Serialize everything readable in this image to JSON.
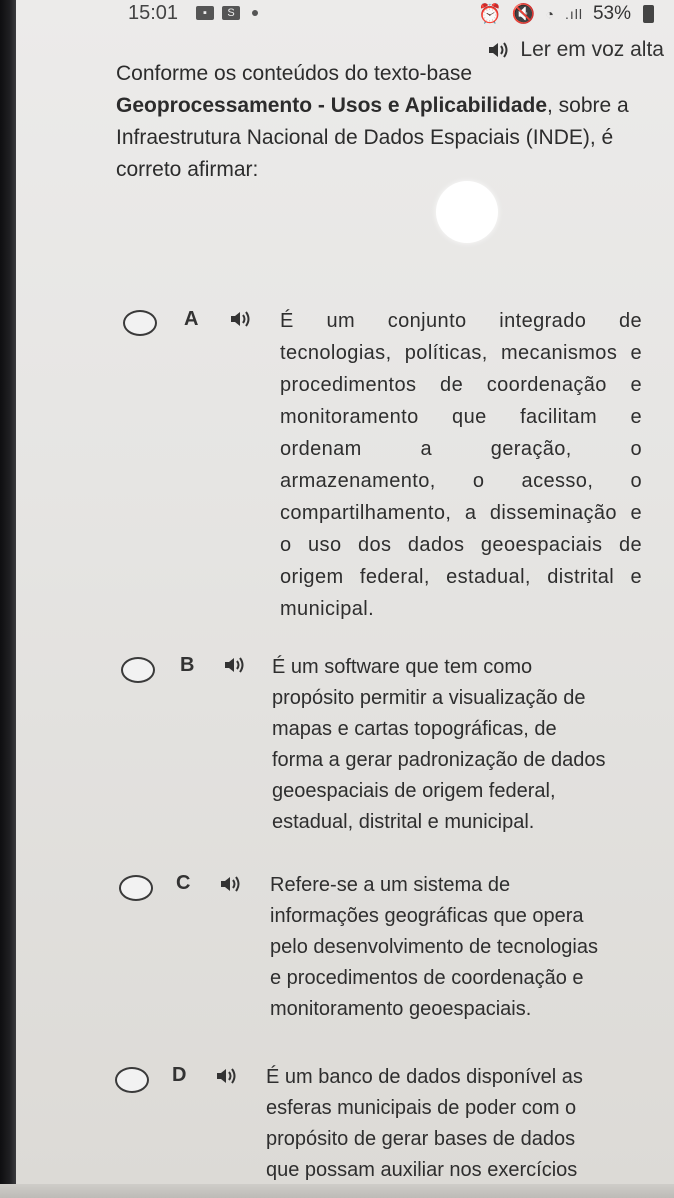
{
  "status_bar": {
    "time": "15:01",
    "mini_icon": "S",
    "battery": "53%"
  },
  "read_aloud": {
    "label": "Ler em voz alta"
  },
  "question": {
    "line1": "Conforme os conteúdos do texto-base",
    "bold": "Geoprocessamento - Usos e Aplicabilidade",
    "line2_rest": ", sobre a",
    "line3": "Infraestrutura Nacional de Dados Espaciais (INDE), é",
    "line4": "correto afirmar:"
  },
  "options": [
    {
      "letter": "A",
      "lines": [
        "É um conjunto integrado de",
        "tecnologias, políticas, mecanismos e",
        "procedimentos de coordenação e",
        "monitoramento que facilitam e",
        "ordenam a geração, o",
        "armazenamento, o acesso, o",
        "compartilhamento, a disseminação e",
        "o uso dos dados geoespaciais de",
        "origem federal, estadual, distrital e",
        "municipal."
      ]
    },
    {
      "letter": "B",
      "lines": [
        "É um software que tem como",
        "propósito permitir a visualização de",
        "mapas e cartas topográficas, de",
        "forma a gerar padronização de dados",
        "geoespaciais de origem federal,",
        "estadual, distrital e municipal."
      ]
    },
    {
      "letter": "C",
      "lines": [
        "Refere-se a um sistema de",
        "informações geográficas que opera",
        "pelo desenvolvimento de tecnologias",
        "e procedimentos de coordenação e",
        "monitoramento geoespaciais."
      ]
    },
    {
      "letter": "D",
      "lines": [
        "É um banco de dados disponível as",
        "esferas municipais de poder com o",
        "propósito de gerar bases de dados",
        "que possam auxiliar nos exercícios"
      ]
    }
  ]
}
